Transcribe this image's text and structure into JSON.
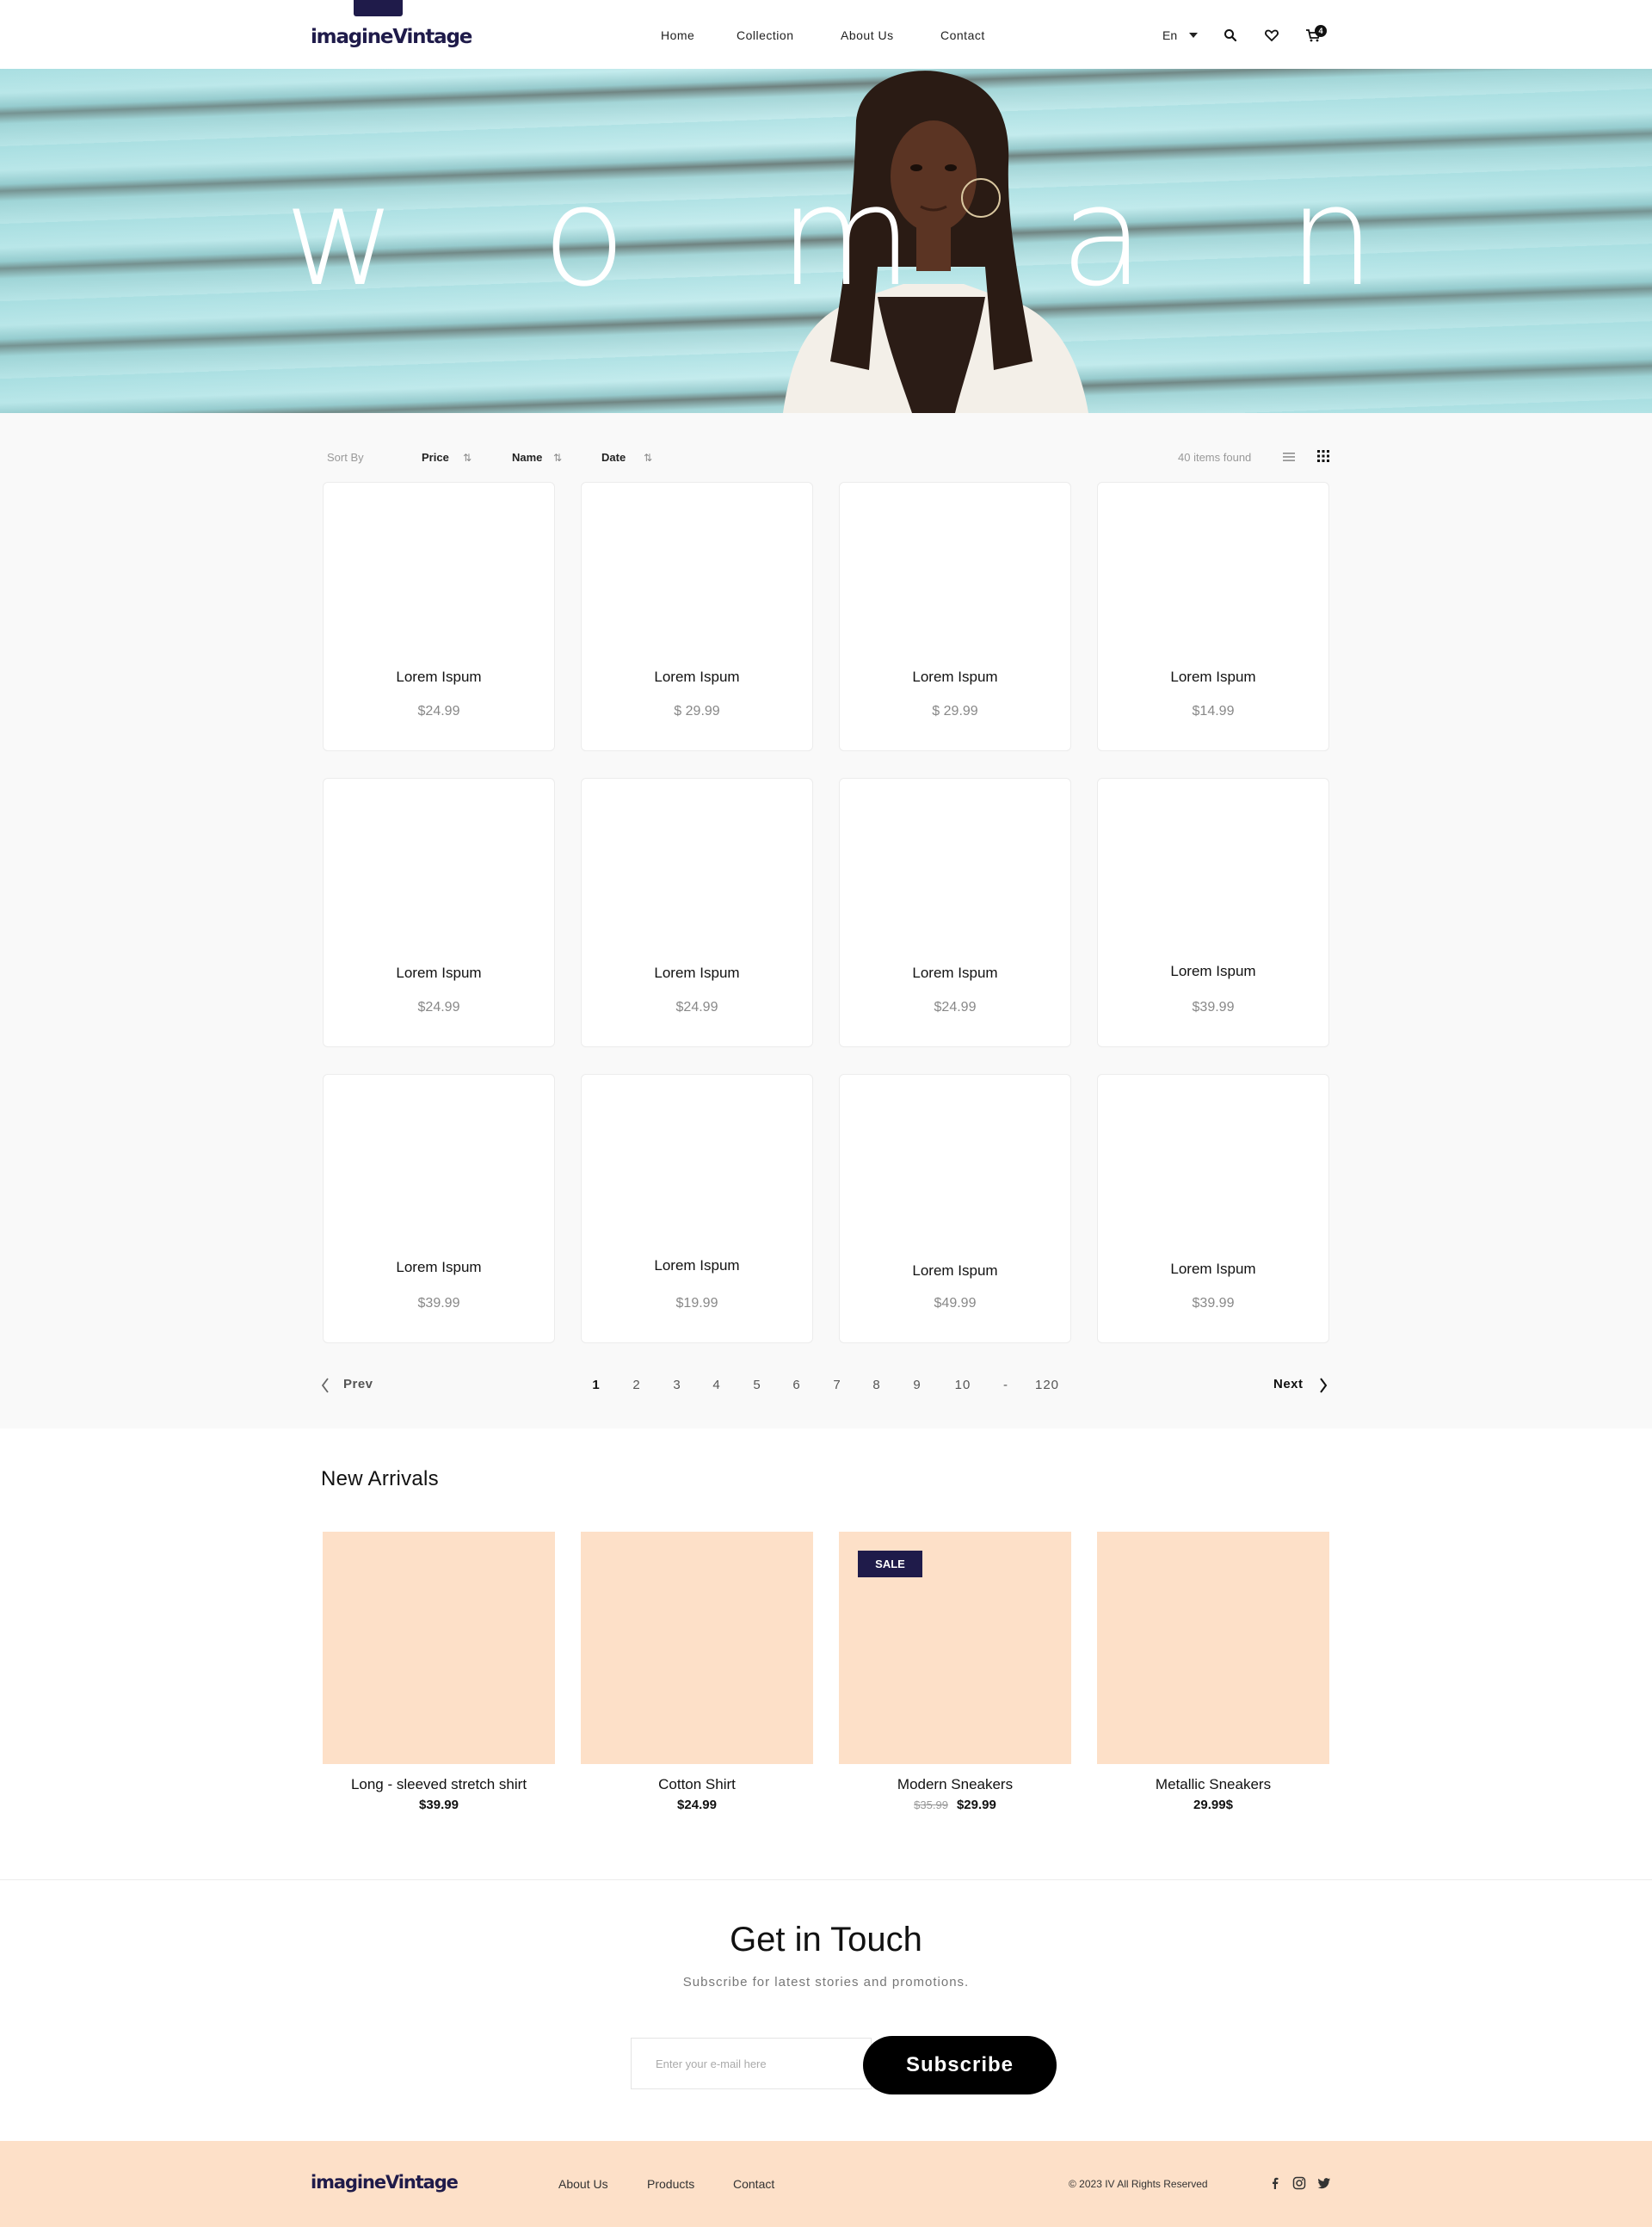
{
  "header": {
    "logo": "imagineVintage",
    "nav": [
      "Home",
      "Collection",
      "About Us",
      "Contact"
    ],
    "language": "En",
    "cart_count": "4"
  },
  "hero": {
    "letters": [
      "w",
      "o",
      "m",
      "a",
      "n"
    ]
  },
  "toolbar": {
    "sort_by": "Sort By",
    "sort_price": "Price",
    "sort_name": "Name",
    "sort_date": "Date",
    "items_found": "40 items found"
  },
  "products": [
    {
      "name": "Lorem Ispum",
      "price": "$24.99"
    },
    {
      "name": "Lorem Ispum",
      "price": "$ 29.99"
    },
    {
      "name": "Lorem Ispum",
      "price": "$ 29.99"
    },
    {
      "name": "Lorem Ispum",
      "price": "$14.99"
    },
    {
      "name": "Lorem Ispum",
      "price": "$24.99"
    },
    {
      "name": "Lorem Ispum",
      "price": "$24.99"
    },
    {
      "name": "Lorem Ispum",
      "price": "$24.99"
    },
    {
      "name": "Lorem Ispum",
      "price": "$39.99"
    },
    {
      "name": "Lorem Ispum",
      "price": "$39.99"
    },
    {
      "name": "Lorem Ispum",
      "price": "$19.99"
    },
    {
      "name": "Lorem Ispum",
      "price": "$49.99"
    },
    {
      "name": "Lorem Ispum",
      "price": "$39.99"
    }
  ],
  "pagination": {
    "prev": "Prev",
    "next": "Next",
    "pages": [
      "1",
      "2",
      "3",
      "4",
      "5",
      "6",
      "7",
      "8",
      "9",
      "10",
      "-",
      "120"
    ],
    "current": "1"
  },
  "new_arrivals": {
    "title": "New Arrivals",
    "sale_label": "SALE",
    "items": [
      {
        "name": "Long - sleeved stretch shirt",
        "price": "$39.99"
      },
      {
        "name": "Cotton Shirt",
        "price": "$24.99"
      },
      {
        "name": "Modern Sneakers",
        "old_price": "$35.99",
        "price": "$29.99"
      },
      {
        "name": "Metallic Sneakers",
        "price": "29.99$"
      }
    ]
  },
  "newsletter": {
    "title": "Get in Touch",
    "subtitle": "Subscribe for latest stories and promotions.",
    "placeholder": "Enter your e-mail here",
    "button": "Subscribe"
  },
  "footer": {
    "logo": "imagineVintage",
    "links": [
      "About Us",
      "Products",
      "Contact"
    ],
    "copyright": "© 2023 IV All Rights Reserved"
  },
  "colors": {
    "brand": "#1f1b4a",
    "peach": "#fde0c8",
    "hero_teal": "#aee0e3"
  },
  "icons": [
    "search-icon",
    "heart-icon",
    "cart-icon",
    "list-view-icon",
    "grid-view-icon",
    "chevron-left-icon",
    "chevron-right-icon",
    "facebook-icon",
    "instagram-icon",
    "twitter-icon"
  ]
}
